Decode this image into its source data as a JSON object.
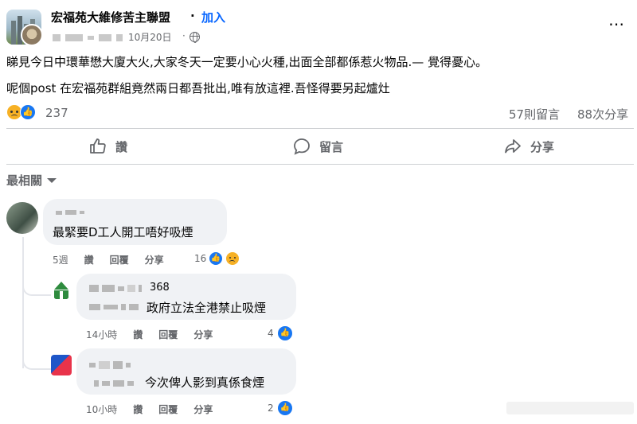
{
  "post": {
    "group_name": "宏福苑大維修苦主聯盟",
    "join_separator": "·",
    "join_label": "加入",
    "date": "10月20日",
    "meta_separator": "·",
    "body_line_1": "睇見今日中環華懋大廈大火,大家冬天一定要小心火種,出面全部都係惹火物品.— 覺得憂心。",
    "body_line_2": "呢個post 在宏福苑群組竟然兩日都吾批出,唯有放這裡.吾怪得要另起爐灶",
    "reaction_count": "237",
    "comment_count": "57則留言",
    "share_count": "88次分享",
    "more_icon": "⋯"
  },
  "actions": {
    "like": "讚",
    "comment": "留言",
    "share": "分享"
  },
  "sort": {
    "label": "最相關"
  },
  "comments": [
    {
      "text": "最緊要D工人開工唔好吸煙",
      "time": "5週",
      "like": "讚",
      "reply": "回覆",
      "share": "分享",
      "reactions": "16"
    },
    {
      "name_suffix": "368",
      "text": "政府立法全港禁止吸煙",
      "time": "14小時",
      "like": "讚",
      "reply": "回覆",
      "share": "分享",
      "reactions": "4"
    },
    {
      "text": "今次俾人影到真係食煙",
      "time": "10小時",
      "like": "讚",
      "reply": "回覆",
      "share": "分享",
      "reactions": "2"
    }
  ],
  "colors": {
    "accent": "#0866ff",
    "like_blue": "#1877f2",
    "sad_yellow": "#f7b125",
    "muted": "#65676b",
    "bubble": "#f0f2f5"
  },
  "icons": [
    "more-icon",
    "globe-icon",
    "like-icon",
    "comment-icon",
    "share-icon",
    "caret-down-icon",
    "like-reaction-icon",
    "sad-reaction-icon"
  ]
}
